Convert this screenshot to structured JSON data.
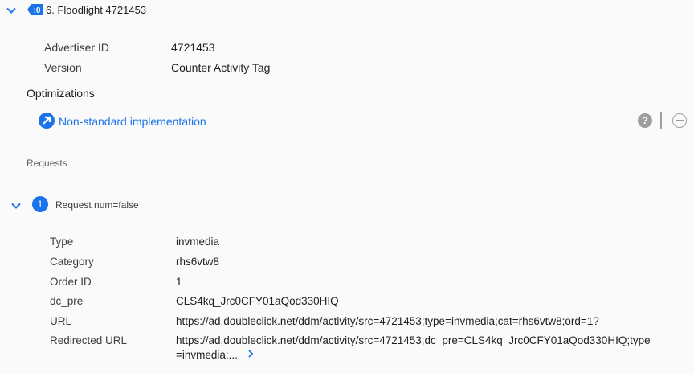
{
  "tag": {
    "title": "6. Floodlight 4721453",
    "details": [
      {
        "label": "Advertiser ID",
        "value": "4721453"
      },
      {
        "label": "Version",
        "value": "Counter Activity Tag"
      }
    ]
  },
  "optimizations": {
    "title": "Optimizations",
    "item_label": "Non-standard implementation"
  },
  "requests": {
    "title": "Requests",
    "badge": "1",
    "request_title": "Request num=false",
    "fields": [
      {
        "label": "Type",
        "value": "invmedia"
      },
      {
        "label": "Category",
        "value": "rhs6vtw8"
      },
      {
        "label": "Order ID",
        "value": "1"
      },
      {
        "label": "dc_pre",
        "value": "CLS4kq_Jrc0CFY01aQod330HIQ"
      },
      {
        "label": "URL",
        "value": "https://ad.doubleclick.net/ddm/activity/src=4721453;type=invmedia;cat=rhs6vtw8;ord=1?"
      },
      {
        "label": "Redirected URL",
        "value": "https://ad.doubleclick.net/ddm/activity/src=4721453;dc_pre=CLS4kq_Jrc0CFY01aQod330HIQ;type",
        "value_line2": "=invmedia;..."
      }
    ]
  },
  "icons": {
    "tag": "tag-icon",
    "expand": "chevron-down-icon",
    "optimization": "arrow-up-right-icon",
    "help": "help-icon",
    "remove": "minus-circle-icon",
    "more": "chevron-right-icon"
  },
  "colors": {
    "accent": "#1a73e8",
    "muted_icon": "#9e9e9e",
    "background": "#fafafa"
  }
}
